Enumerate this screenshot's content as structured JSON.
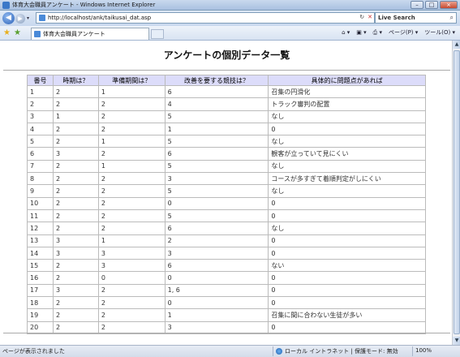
{
  "window": {
    "title": "体育大会職員アンケート - Windows Internet Explorer",
    "min_label": "–",
    "max_label": "□",
    "close_label": "×"
  },
  "address_bar": {
    "back_label": "◀",
    "forward_label": "▶",
    "dropdown_label": "▾",
    "url": "http://localhost/ank/taikusai_dat.asp",
    "refresh_label": "↻",
    "stop_label": "✕",
    "search_label": "Live Search",
    "search_button": "⌕"
  },
  "tabs": {
    "active_tab_title": "体育大会職員アンケート"
  },
  "command_bar": {
    "home_label": "⌂ ▾",
    "feeds_label": "▣ ▾",
    "print_label": "⎙ ▾",
    "page_label": "ページ(P) ▾",
    "tools_label": "ツール(O) ▾"
  },
  "page": {
    "title": "アンケートの個別データ一覧"
  },
  "table": {
    "headers": [
      "番号",
      "時期は？",
      "準備期間は？",
      "改善を要する競技は？",
      "具体的に問題点があれば"
    ],
    "rows": [
      [
        "1",
        "2",
        "1",
        "6",
        "召集の円滑化"
      ],
      [
        "2",
        "2",
        "2",
        "4",
        "トラック審判の配置"
      ],
      [
        "3",
        "1",
        "2",
        "5",
        "なし"
      ],
      [
        "4",
        "2",
        "2",
        "1",
        "0"
      ],
      [
        "5",
        "2",
        "1",
        "5",
        "なし"
      ],
      [
        "6",
        "3",
        "2",
        "6",
        "観客が立っていて見にくい"
      ],
      [
        "7",
        "2",
        "1",
        "5",
        "なし"
      ],
      [
        "8",
        "2",
        "2",
        "3",
        "コースが多すぎて着順判定がしにくい"
      ],
      [
        "9",
        "2",
        "2",
        "5",
        "なし"
      ],
      [
        "10",
        "2",
        "2",
        "0",
        "0"
      ],
      [
        "11",
        "2",
        "2",
        "5",
        "0"
      ],
      [
        "12",
        "2",
        "2",
        "6",
        "なし"
      ],
      [
        "13",
        "3",
        "1",
        "2",
        "0"
      ],
      [
        "14",
        "3",
        "3",
        "3",
        "0"
      ],
      [
        "15",
        "2",
        "3",
        "6",
        "ない"
      ],
      [
        "16",
        "2",
        "0",
        "0",
        "0"
      ],
      [
        "17",
        "3",
        "2",
        "1, 6",
        "0"
      ],
      [
        "18",
        "2",
        "2",
        "0",
        "0"
      ],
      [
        "19",
        "2",
        "2",
        "1",
        "召集に間に合わない生徒が多い"
      ],
      [
        "20",
        "2",
        "2",
        "3",
        "0"
      ]
    ]
  },
  "status_bar": {
    "status_text": "ページが表示されました",
    "zone_text": "ローカル イントラネット | 保護モード: 無効",
    "zoom_text": "100%"
  },
  "colors": {
    "header_bg": "#dcdcfa",
    "chrome_blue": "#c8d8ee"
  }
}
